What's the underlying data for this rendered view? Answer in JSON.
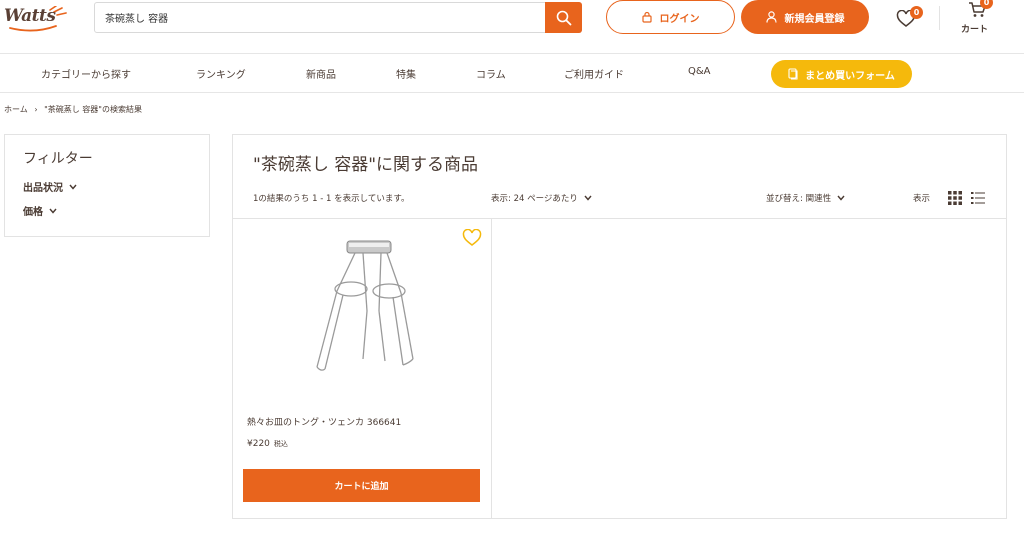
{
  "brand": {
    "logo_text": "Watts",
    "color": "#e8641d",
    "yellow": "#f5b90c"
  },
  "search": {
    "value": "茶碗蒸し 容器",
    "icon": "search-icon"
  },
  "header": {
    "login_label": "ログイン",
    "register_label": "新規会員登録",
    "wishlist_count": "0",
    "cart_count": "0",
    "cart_label": "カート"
  },
  "nav": {
    "items": [
      "カテゴリーから探す",
      "ランキング",
      "新商品",
      "特集",
      "コラム",
      "ご利用ガイド",
      "Q&A"
    ],
    "bulk_order_label": "まとめ買いフォーム"
  },
  "breadcrumb": {
    "home": "ホーム",
    "separator": "›",
    "current": "\"茶碗蒸し 容器\"の検索結果"
  },
  "filter": {
    "title": "フィルター",
    "items": [
      "出品状況",
      "価格"
    ]
  },
  "results": {
    "title": "\"茶碗蒸し 容器\"に関する商品",
    "count_text": "1の結果のうち 1 - 1 を表示しています。",
    "per_page": "表示: 24 ページあたり",
    "sort": "並び替え: 関連性",
    "view_label": "表示"
  },
  "products": [
    {
      "name": "熱々お皿のトング・ツェンカ 366641",
      "price": "¥220",
      "tax_label": "税込",
      "add_to_cart": "カートに追加"
    }
  ]
}
